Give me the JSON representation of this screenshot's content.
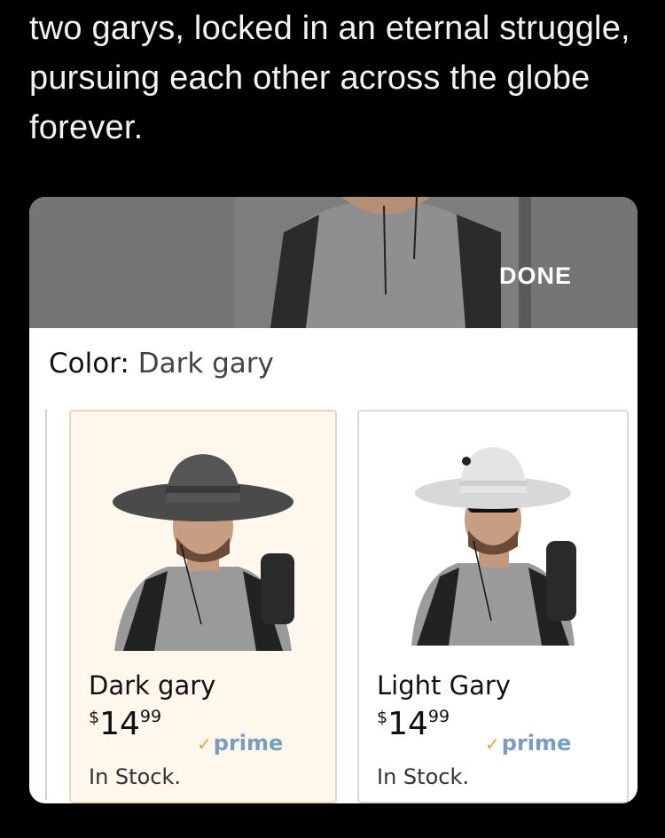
{
  "caption": "two garys, locked in an eternal struggle, pursuing each other across the globe forever.",
  "selector": {
    "done_label": "DONE",
    "color_label": "Color:",
    "color_value": "Dark gary"
  },
  "options": [
    {
      "name": "Dark gary",
      "currency": "$",
      "price_whole": "14",
      "price_cents": "99",
      "prime": "prime",
      "stock": "In Stock.",
      "selected": true
    },
    {
      "name": "Light Gary",
      "currency": "$",
      "price_whole": "14",
      "price_cents": "99",
      "prime": "prime",
      "stock": "In Stock.",
      "selected": false
    }
  ],
  "colors": {
    "background": "#000000",
    "preview_gray": "#757575",
    "selected_card": "#fdf7ec",
    "prime_blue": "#7a9cc0",
    "prime_check": "#e8a33c"
  }
}
